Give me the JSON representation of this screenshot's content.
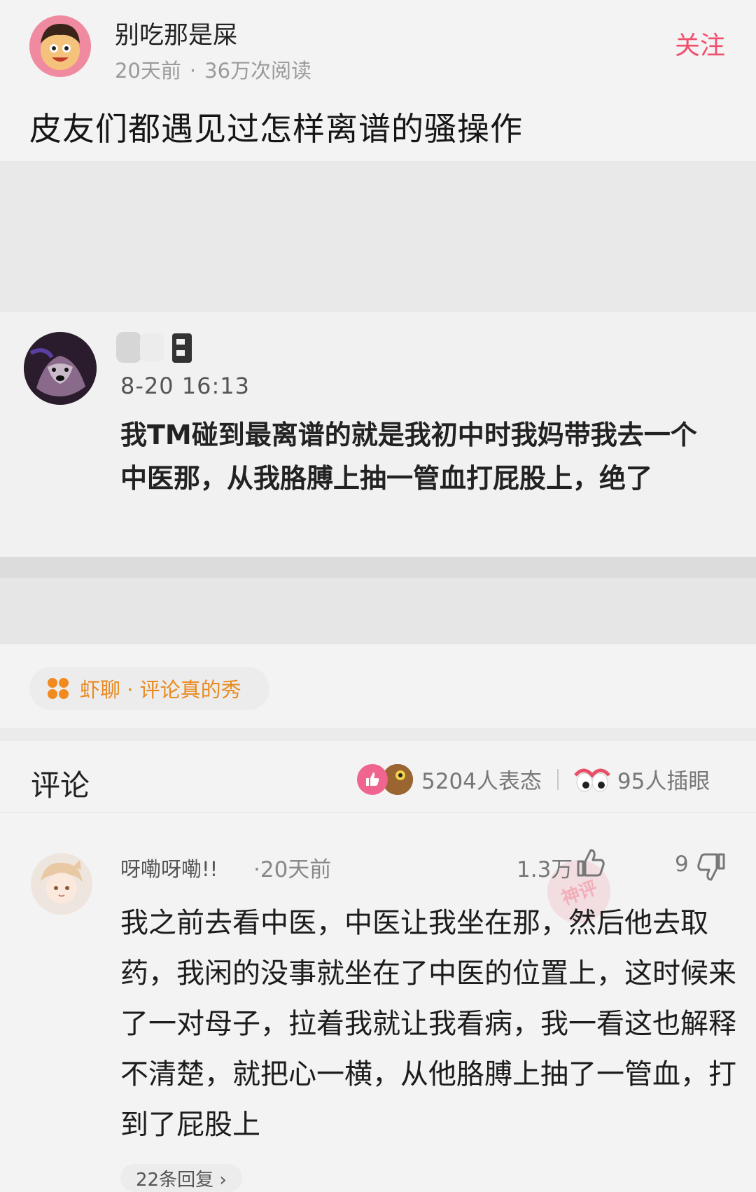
{
  "post": {
    "author": "别吃那是屎",
    "time": "20天前",
    "separator": "·",
    "reads": "36万次阅读",
    "follow_label": "关注",
    "title": "皮友们都遇见过怎样离谱的骚操作"
  },
  "embedded_comment": {
    "time": "8-20 16:13",
    "text": "我TM碰到最离谱的就是我初中时我妈带我去一个中医那，从我胳膊上抽一管血打屁股上，绝了"
  },
  "topic": {
    "icon": "four-dots-icon",
    "label": "虾聊 · 评论真的秀"
  },
  "comments_header": {
    "title": "评论",
    "reactions_label": "5204人表态",
    "eyes_label": "95人插眼"
  },
  "comment": {
    "user": "呀嘞呀嘞!!",
    "time": "·20天前",
    "likes": "1.3万",
    "dislikes": "9",
    "watermark": "神评",
    "text": "我之前去看中医，中医让我坐在那，然后他去取药，我闲的没事就坐在了中医的位置上，这时候来了一对母子，拉着我就让我看病，我一看这也解释不清楚，就把心一横，从他胳膊上抽了一管血，打到了屁股上",
    "replies": "22条回复 ›"
  },
  "colors": {
    "accent": "#f0506e",
    "topic": "#e98a20",
    "background": "#f3f3f3"
  }
}
